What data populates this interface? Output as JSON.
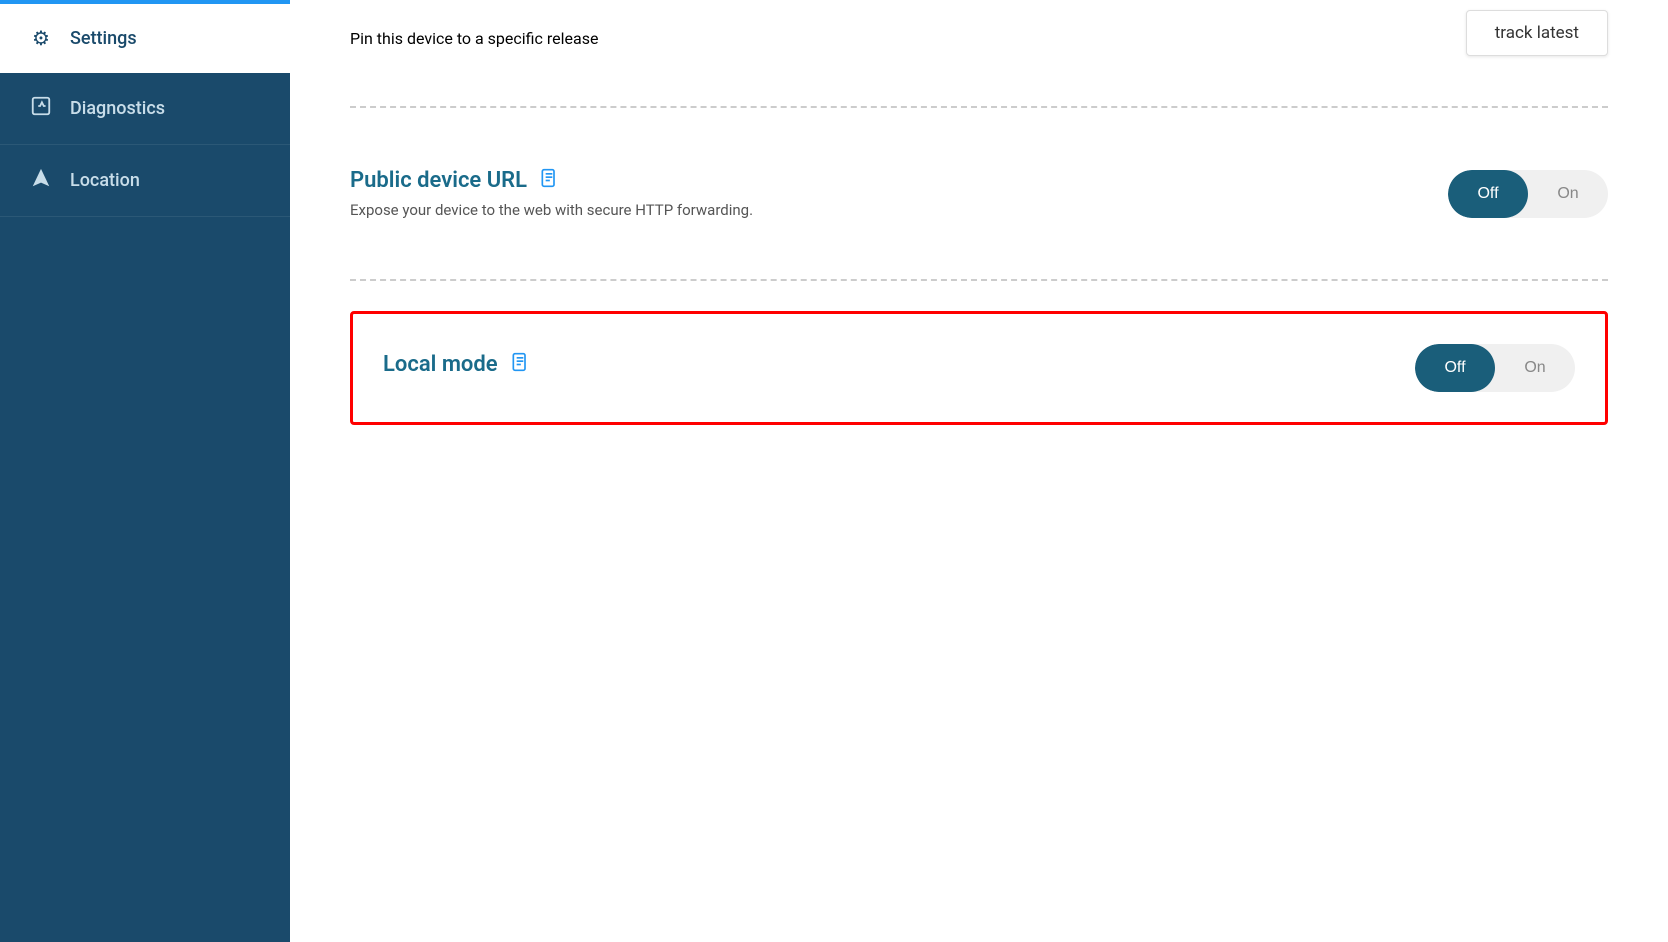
{
  "sidebar": {
    "items": [
      {
        "id": "settings",
        "label": "Settings",
        "icon": "⚙",
        "active": true
      },
      {
        "id": "diagnostics",
        "label": "Diagnostics",
        "icon": "🩺",
        "active": false
      },
      {
        "id": "location",
        "label": "Location",
        "icon": "➤",
        "active": false
      }
    ]
  },
  "main": {
    "release": {
      "pin_text": "Pin this device to a specific release",
      "track_badge": "track latest"
    },
    "public_device_url": {
      "title": "Public device URL",
      "description": "Expose your device to the web with secure HTTP forwarding.",
      "state": "off",
      "off_label": "Off",
      "on_label": "On"
    },
    "local_mode": {
      "title": "Local mode",
      "state": "off",
      "off_label": "Off",
      "on_label": "On",
      "highlighted": true
    }
  }
}
